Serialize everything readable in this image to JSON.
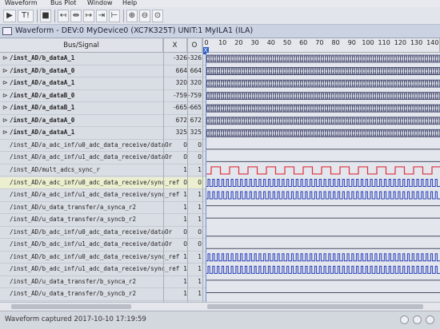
{
  "menu": [
    "Waveform",
    "Bus Plot",
    "Window",
    "Help"
  ],
  "window": {
    "title": "Waveform - DEV:0 MyDevice0 (XC7K325T) UNIT:1 MyILA1 (ILA)"
  },
  "columns": {
    "bus_signal": "Bus/Signal",
    "x": "X",
    "o": "O"
  },
  "timeline": {
    "ticks": [
      "0",
      "10",
      "20",
      "30",
      "40",
      "50",
      "60",
      "70",
      "80",
      "90",
      "100",
      "110",
      "120",
      "130",
      "140"
    ],
    "cursor_label": "X"
  },
  "signals": [
    {
      "name": "/inst_AD/b_dataA_1",
      "x": "-326",
      "o": "-326",
      "kind": "bus"
    },
    {
      "name": "/inst_AD/b_dataA_0",
      "x": "664",
      "o": "664",
      "kind": "bus"
    },
    {
      "name": "/inst_AD/a_dataA_1",
      "x": "320",
      "o": "320",
      "kind": "bus"
    },
    {
      "name": "/inst_AD/a_dataB_0",
      "x": "-759",
      "o": "-759",
      "kind": "bus"
    },
    {
      "name": "/inst_AD/a_dataB_1",
      "x": "-665",
      "o": "-665",
      "kind": "bus"
    },
    {
      "name": "/inst_AD/a_dataA_0",
      "x": "672",
      "o": "672",
      "kind": "bus"
    },
    {
      "name": "/inst_AD/a_dataA_1",
      "x": "325",
      "o": "325",
      "kind": "bus"
    },
    {
      "name": "/inst_AD/a_adc_inf/u0_adc_data_receive/dataOr",
      "x": "0",
      "o": "0",
      "kind": "flat"
    },
    {
      "name": "/inst_AD/a_adc_inf/u1_adc_data_receive/dataOr",
      "x": "0",
      "o": "0",
      "kind": "flat"
    },
    {
      "name": "/inst_AD/mult_adcs_sync_r",
      "x": "1",
      "o": "1",
      "kind": "clock"
    },
    {
      "name": "/inst_AD/a_adc_inf/u0_adc_data_receive/sync_ref",
      "x": "0",
      "o": "0",
      "kind": "pulses",
      "selected": true
    },
    {
      "name": "/inst_AD/a_adc_inf/u1_adc_data_receive/sync_ref",
      "x": "1",
      "o": "1",
      "kind": "pulses"
    },
    {
      "name": "/inst_AD/u_data_transfer/a_synca_r2",
      "x": "1",
      "o": "1",
      "kind": "flat"
    },
    {
      "name": "/inst_AD/u_data_transfer/a_syncb_r2",
      "x": "1",
      "o": "1",
      "kind": "flat"
    },
    {
      "name": "/inst_AD/b_adc_inf/u0_adc_data_receive/dataOr",
      "x": "0",
      "o": "0",
      "kind": "flat"
    },
    {
      "name": "/inst_AD/b_adc_inf/u1_adc_data_receive/dataOr",
      "x": "0",
      "o": "0",
      "kind": "flat"
    },
    {
      "name": "/inst_AD/b_adc_inf/u0_adc_data_receive/sync_ref",
      "x": "1",
      "o": "1",
      "kind": "pulses"
    },
    {
      "name": "/inst_AD/b_adc_inf/u1_adc_data_receive/sync_ref",
      "x": "1",
      "o": "1",
      "kind": "pulses"
    },
    {
      "name": "/inst_AD/u_data_transfer/b_synca_r2",
      "x": "1",
      "o": "1",
      "kind": "flat"
    },
    {
      "name": "/inst_AD/u_data_transfer/b_syncb_r2",
      "x": "1",
      "o": "1",
      "kind": "flat"
    }
  ],
  "status": {
    "text": "Waveform captured 2017-10-10 17:19:59"
  },
  "colors": {
    "bus": "#3a3e66",
    "clock": "#e0303c",
    "signal": "#2a3fb8",
    "flat": "#4a4d63"
  }
}
